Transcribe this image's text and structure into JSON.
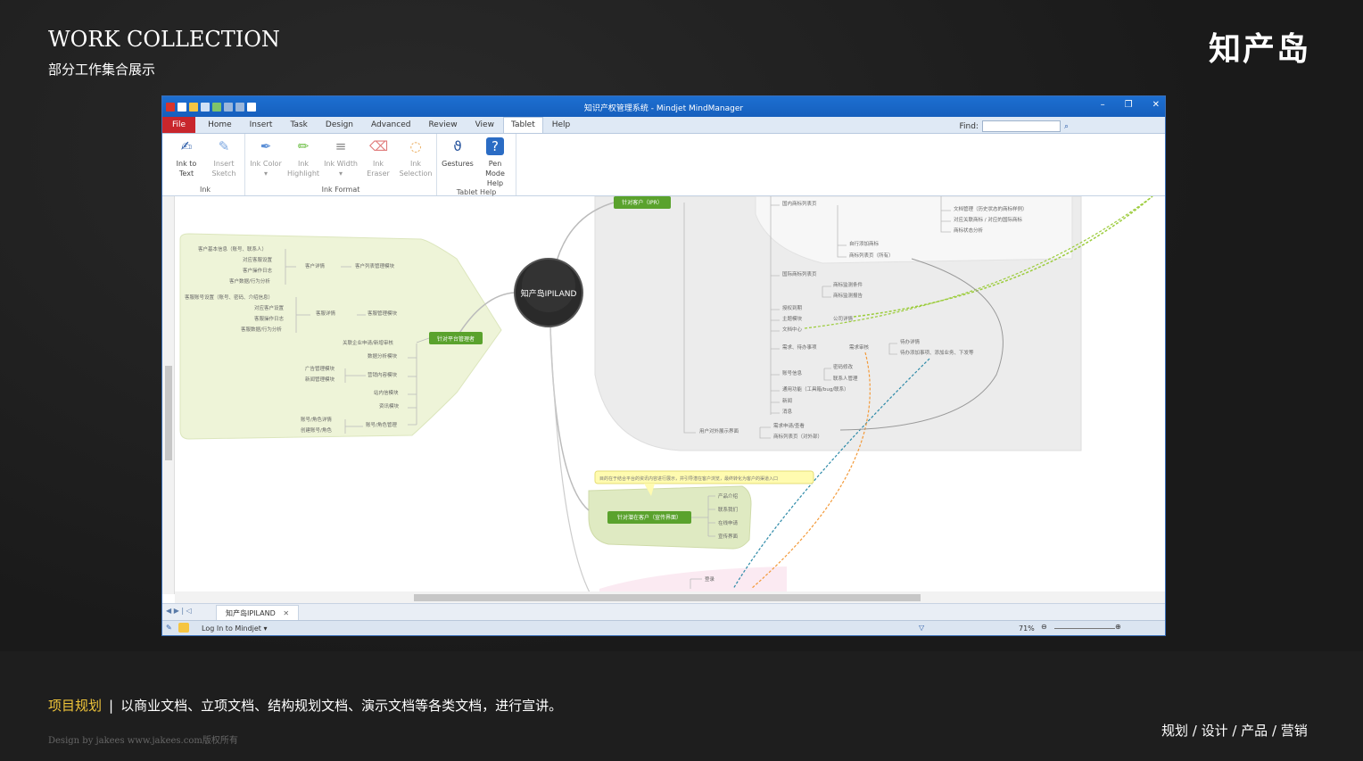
{
  "slide": {
    "title": "WORK COLLECTION",
    "subtitle": "部分工作集合展示",
    "logo": "知产岛",
    "caption_highlight": "项目规划",
    "caption_sep": "|",
    "caption_text": "以商业文档、立项文档、结构规划文档、演示文档等各类文档，进行宣讲。",
    "credit": "Design by jakees   www.jakees.com版权所有",
    "tags": "规划 / 设计 / 产品 / 营销"
  },
  "window": {
    "title": "知识产权管理系统 - Mindjet MindManager",
    "controls": [
      "–",
      "❐",
      "✕"
    ],
    "tabs": [
      "File",
      "Home",
      "Insert",
      "Task",
      "Design",
      "Advanced",
      "Review",
      "View",
      "Tablet",
      "Help"
    ],
    "active_tab": "Tablet",
    "find_label": "Find:",
    "ribbon": {
      "groups": [
        {
          "label": "Ink",
          "buttons": [
            {
              "label": "Ink to Text",
              "icon": "✍",
              "dim": false
            },
            {
              "label": "Insert Sketch",
              "icon": "✎",
              "dim": true
            }
          ]
        },
        {
          "label": "Ink Format",
          "buttons": [
            {
              "label": "Ink Color ▾",
              "icon": "✒",
              "dim": true
            },
            {
              "label": "Ink Highlight",
              "icon": "✏",
              "dim": true
            },
            {
              "label": "Ink Width ▾",
              "icon": "≡",
              "dim": true
            },
            {
              "label": "Ink Eraser",
              "icon": "⌫",
              "dim": true
            },
            {
              "label": "Ink Selection",
              "icon": "◌",
              "dim": true
            }
          ]
        },
        {
          "label": "Tablet Help",
          "buttons": [
            {
              "label": "Gestures",
              "icon": "ϑ",
              "dim": false
            },
            {
              "label": "Pen Mode Help",
              "icon": "?",
              "dim": false
            }
          ]
        }
      ]
    },
    "doc_tab": "知产岛IPILAND",
    "status": {
      "login": "Log In to Mindjet ▾",
      "zoom": "71%"
    }
  },
  "mindmap": {
    "central": "知产岛IPILAND",
    "left_branch": {
      "title": "针对平台管理者",
      "items": [
        "客户基本信息（账号、联系人）",
        "对应客服设置",
        "客户操作日志",
        "客户数据/行为分析",
        "客服账号设置（账号、密码、介绍信息）",
        "对应客户设置",
        "客服操作日志",
        "客服数据/行为分析",
        "客户详情",
        "客户列表管理模块",
        "客服详情",
        "客服管理模块",
        "关联企业申请/新增审核",
        "数据分析模块",
        "广告管理模块",
        "新闻管理模块",
        "营销内容模块",
        "站内信模块",
        "资讯模块",
        "账号/角色详情",
        "创建账号/角色",
        "账号/角色管理"
      ]
    },
    "top_branch": {
      "title": "针对客户（IPR）",
      "items": [
        "国内商标列表页",
        "文档管理（历史状态的商标样例）",
        "对应关联商标 / 对应的国际商标",
        "商标状态分析",
        "自行添加商标",
        "商标列表页（所有）",
        "国际商标列表页",
        "商标监测条件",
        "商标监测报告",
        "授权到期",
        "主题模块",
        "公司详情",
        "文档中心",
        "需求、待办事项",
        "需求审核",
        "待办详情",
        "待办添加事项、添加业务、下发等",
        "账号信息",
        "密码修改",
        "联系人管理",
        "通用功能（工具箱/bug/联系）",
        "新闻",
        "消息",
        "用户对外展示界面",
        "需求申请/查看",
        "商标列表页（对外部）"
      ]
    },
    "bottom_branch": {
      "title": "针对潜在客户（宣传界面）",
      "callout": "目的在于结合平台的资讯内容进行展示，并引导潜在客户浏览，最终转化为客户的渠道入口",
      "items": [
        "产品介绍",
        "联系我们",
        "在线申请",
        "宣传界面"
      ]
    },
    "bottom_stub": "登录"
  }
}
